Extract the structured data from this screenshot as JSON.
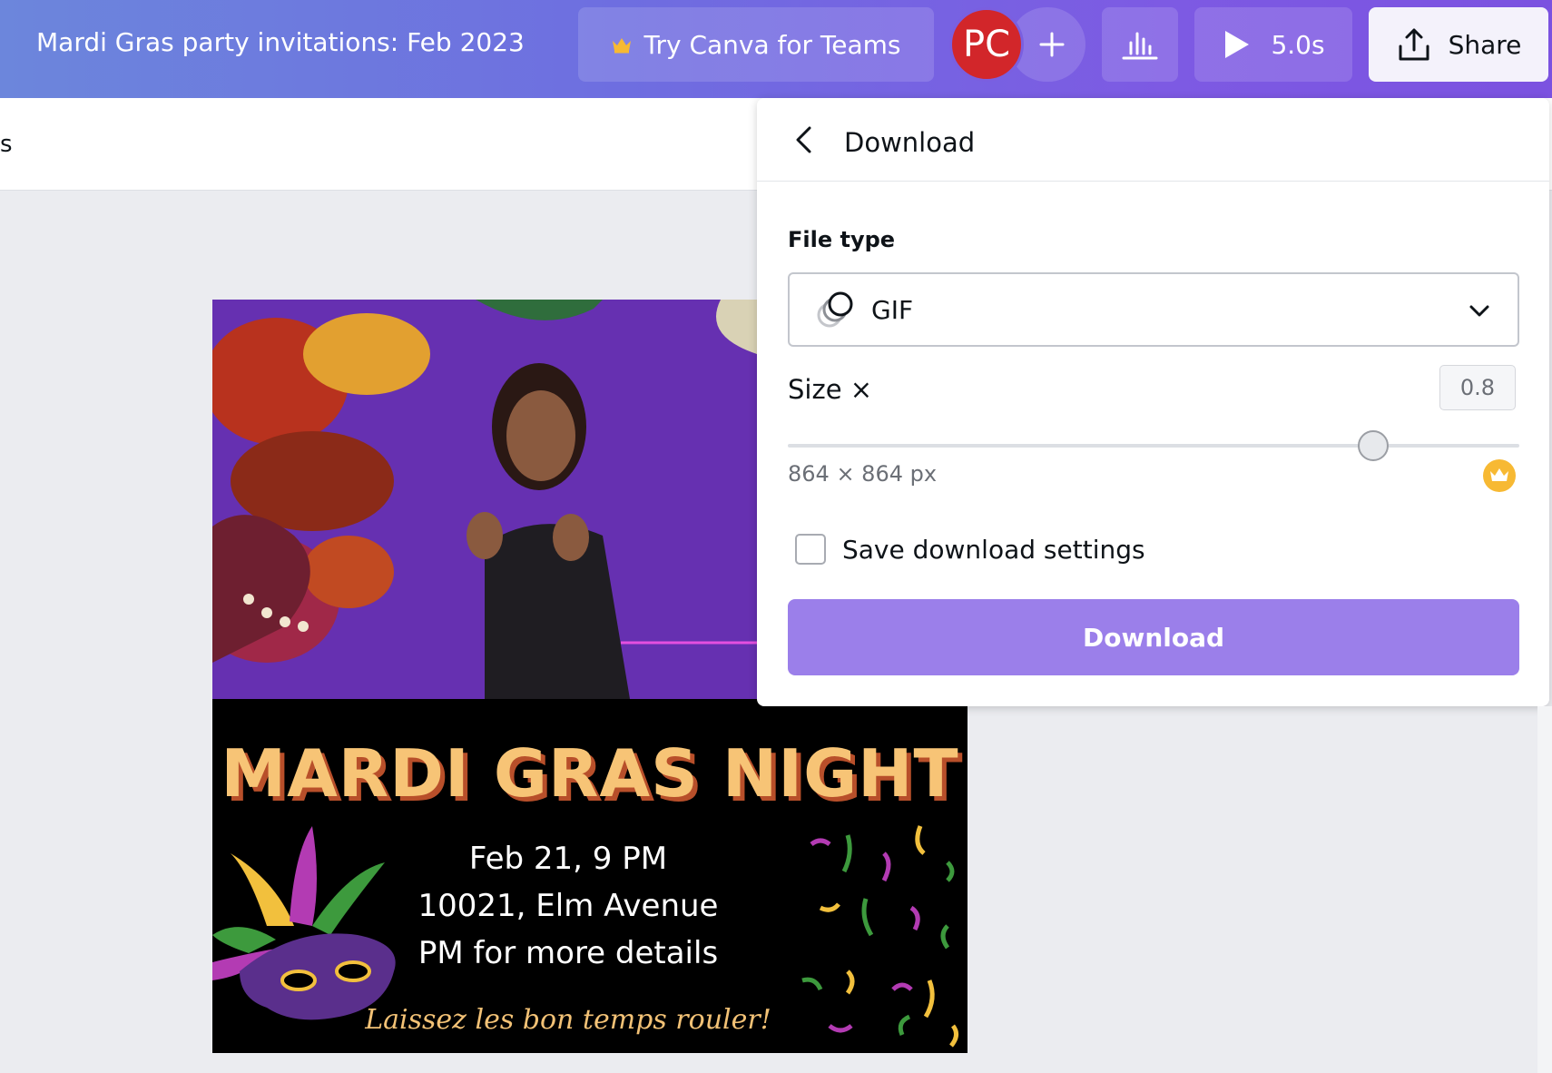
{
  "header": {
    "doc_title": "Mardi Gras party invitations: Feb 2023",
    "teams_label": "Try Canva for Teams",
    "avatar_initials": "PC",
    "play_duration": "5.0s",
    "share_label": "Share",
    "accent_color": "#7b5ce0"
  },
  "subbar": {
    "text": "s"
  },
  "design": {
    "title": "MARDI GRAS NIGHT",
    "lines": [
      "Feb 21, 9 PM",
      "10021, Elm Avenue",
      "PM for more details"
    ],
    "tagline": "Laissez les bon temps rouler!"
  },
  "download_panel": {
    "title": "Download",
    "file_type_label": "File type",
    "file_type_value": "GIF",
    "size_label": "Size ×",
    "size_value": "0.8",
    "size_slider_fraction": 0.8,
    "dimensions": "864 × 864 px",
    "save_settings_label": "Save download settings",
    "save_settings_checked": false,
    "download_button": "Download",
    "button_color": "#9b7fea"
  },
  "icons": {
    "teams": "crown-icon",
    "add": "plus-icon",
    "insights": "bar-chart-icon",
    "play": "play-icon",
    "share": "upload-icon",
    "back": "chevron-left-icon",
    "file_type": "gif-icon",
    "dropdown": "chevron-down-icon",
    "pro": "crown-icon"
  }
}
